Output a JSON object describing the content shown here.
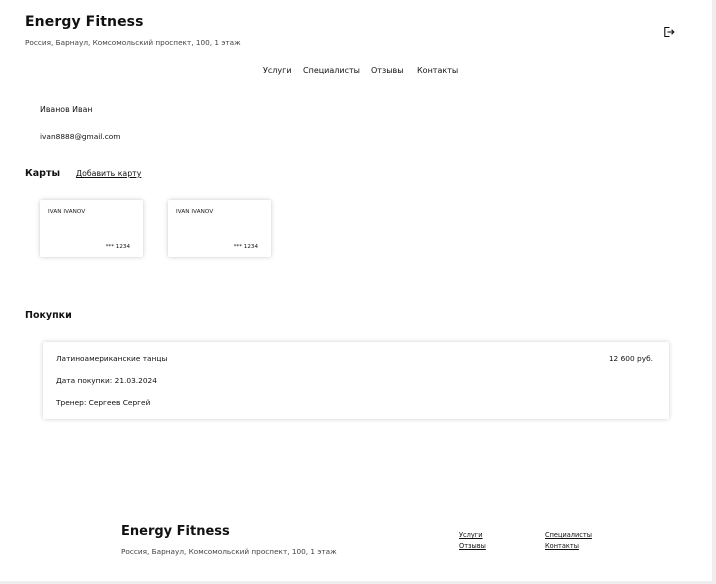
{
  "header": {
    "brand": "Energy Fitness",
    "address": "Россия, Барнаул, Комсомольский проспект, 100, 1 этаж",
    "logout_icon": "logout-icon"
  },
  "nav": [
    "Услуги",
    "Специалисты",
    "Отзывы",
    "Контакты"
  ],
  "user": {
    "name": "Иванов Иван",
    "email": "ivan8888@gmail.com"
  },
  "cards_section": {
    "title": "Карты",
    "add_label": "Добавить карту",
    "cards": [
      {
        "holder": "IVAN IVANOV",
        "number": "*** 1234"
      },
      {
        "holder": "IVAN IVANOV",
        "number": "*** 1234"
      }
    ]
  },
  "purchases_section": {
    "title": "Покупки",
    "items": [
      {
        "name": "Латиноамериканские танцы",
        "price": "12 600 руб.",
        "date": "Дата покупки: 21.03.2024",
        "trainer": "Тренер: Сергеев Сергей"
      }
    ]
  },
  "footer": {
    "brand": "Energy Fitness",
    "address": "Россия, Барнаул, Комсомольский проспект, 100, 1 этаж",
    "links": [
      "Услуги",
      "Отзывы",
      "Специалисты",
      "Контакты"
    ]
  }
}
